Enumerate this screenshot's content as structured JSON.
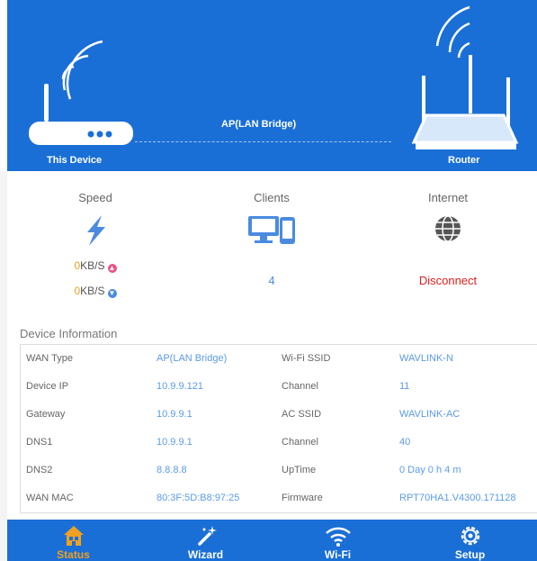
{
  "hero": {
    "left_label": "This Device",
    "right_label": "Router",
    "mode": "AP(LAN Bridge)"
  },
  "stats": {
    "speed": {
      "title": "Speed",
      "up_value": "0",
      "down_value": "0",
      "unit": "KB/S"
    },
    "clients": {
      "title": "Clients",
      "count": "4"
    },
    "internet": {
      "title": "Internet",
      "status": "Disconnect"
    }
  },
  "device_info": {
    "title": "Device Information",
    "rows": [
      {
        "k1": "WAN Type",
        "v1": "AP(LAN Bridge)",
        "k2": "Wi-Fi SSID",
        "v2": "WAVLINK-N"
      },
      {
        "k1": "Device IP",
        "v1": "10.9.9.121",
        "k2": "Channel",
        "v2": "11"
      },
      {
        "k1": "Gateway",
        "v1": "10.9.9.1",
        "k2": "AC SSID",
        "v2": "WAVLINK-AC"
      },
      {
        "k1": "DNS1",
        "v1": "10.9.9.1",
        "k2": "Channel",
        "v2": "40"
      },
      {
        "k1": "DNS2",
        "v1": "8.8.8.8",
        "k2": "UpTime",
        "v2": "0 Day 0 h 4 m"
      },
      {
        "k1": "WAN MAC",
        "v1": "80:3F:5D:B8:97:25",
        "k2": "Firmware",
        "v2": "RPT70HA1.V4300.171128"
      }
    ]
  },
  "tabs": [
    {
      "label": "Status",
      "icon": "home-icon",
      "active": true
    },
    {
      "label": "Wizard",
      "icon": "wand-icon",
      "active": false
    },
    {
      "label": "Wi-Fi",
      "icon": "wifi-icon",
      "active": false
    },
    {
      "label": "Setup",
      "icon": "gear-icon",
      "active": false
    }
  ],
  "colors": {
    "brand_blue": "#1a6fd6",
    "accent_orange": "#f0a020",
    "value_blue": "#5b9be8",
    "error_red": "#e02020"
  }
}
